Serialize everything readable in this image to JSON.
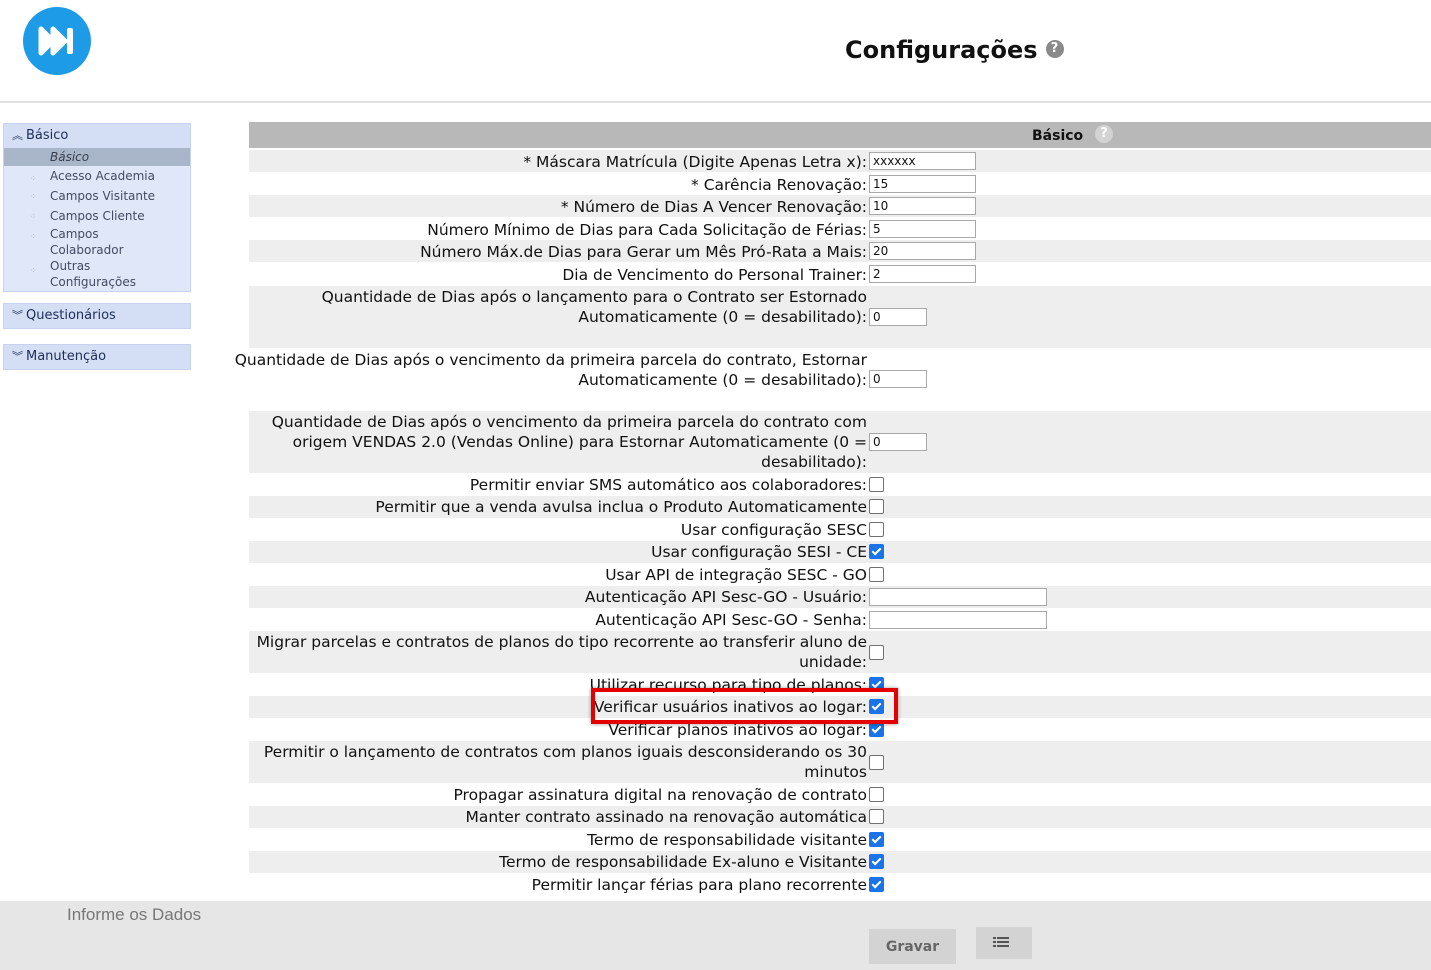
{
  "header": {
    "title": "Configurações",
    "help": "?"
  },
  "sidebar": {
    "sections": [
      {
        "label": "Básico",
        "expanded": true
      },
      {
        "label": "Questionários",
        "expanded": false
      },
      {
        "label": "Manutenção",
        "expanded": false
      }
    ],
    "items": [
      {
        "label": "Básico",
        "selected": true
      },
      {
        "label": "Acesso Academia"
      },
      {
        "label": "Campos Visitante"
      },
      {
        "label": "Campos Cliente"
      },
      {
        "label": "Campos Colaborador"
      },
      {
        "label": "Outras Configurações"
      }
    ]
  },
  "form": {
    "heading": "Básico",
    "help": "?",
    "rows": [
      {
        "label": "* Máscara Matrícula (Digite Apenas Letra x):",
        "value": "xxxxxx"
      },
      {
        "label": "* Carência Renovação:",
        "value": "15"
      },
      {
        "label": "* Número de Dias A Vencer Renovação:",
        "value": "10"
      },
      {
        "label": "Número Mínimo de Dias para Cada Solicitação de Férias:",
        "value": "5"
      },
      {
        "label": "Número Máx.de Dias para Gerar um Mês Pró-Rata a Mais:",
        "value": "20"
      },
      {
        "label": "Dia de Vencimento do Personal Trainer:",
        "value": "2"
      },
      {
        "label": "Quantidade de Dias após o lançamento para o Contrato ser Estornado Automaticamente (0 = desabilitado):",
        "value": "0"
      },
      {
        "label": "Quantidade de Dias após o vencimento da primeira parcela do contrato, Estornar Automaticamente (0 = desabilitado):",
        "value": "0"
      },
      {
        "label": "Quantidade de Dias após o vencimento da primeira parcela do contrato com origem VENDAS 2.0 (Vendas Online) para Estornar Automaticamente (0 = desabilitado):",
        "value": "0"
      },
      {
        "label": "Permitir enviar SMS automático aos colaboradores:",
        "checked": false
      },
      {
        "label": "Permitir que a venda avulsa inclua o Produto Automaticamente",
        "checked": false
      },
      {
        "label": "Usar configuração SESC",
        "checked": false
      },
      {
        "label": "Usar configuração SESI - CE",
        "checked": true
      },
      {
        "label": "Usar API de integração SESC - GO",
        "checked": false
      },
      {
        "label": "Autenticação API Sesc-GO - Usuário:",
        "value": ""
      },
      {
        "label": "Autenticação API Sesc-GO - Senha:",
        "value": ""
      },
      {
        "label": "Migrar parcelas e contratos de planos do tipo recorrente ao transferir aluno de unidade:",
        "checked": false
      },
      {
        "label": "Utilizar recurso para tipo de planos:",
        "checked": true
      },
      {
        "label": "Verificar usuários inativos ao logar:",
        "checked": true
      },
      {
        "label": "Verificar planos inativos ao logar:",
        "checked": true
      },
      {
        "label": "Permitir o lançamento de contratos com planos iguais desconsiderando os 30 minutos",
        "checked": false
      },
      {
        "label": "Propagar assinatura digital na renovação de contrato",
        "checked": false
      },
      {
        "label": "Manter contrato assinado na renovação automática",
        "checked": false
      },
      {
        "label": "Termo de responsabilidade visitante",
        "checked": true
      },
      {
        "label": "Termo de responsabilidade Ex-aluno e Visitante",
        "checked": true
      },
      {
        "label": "Permitir lançar férias para plano recorrente",
        "checked": true
      }
    ]
  },
  "footer": {
    "info": "Informe os Dados",
    "save_label": "Gravar"
  }
}
